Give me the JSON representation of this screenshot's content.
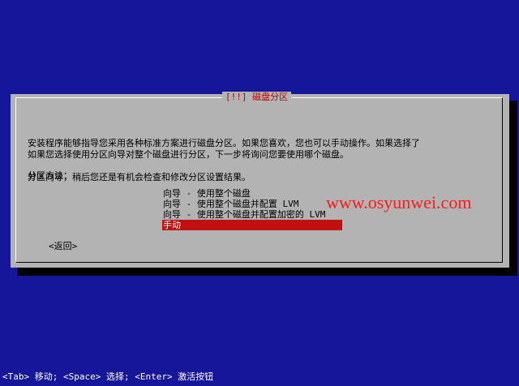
{
  "dialog": {
    "title": "[!!] 磁盘分区",
    "description_line1": "安装程序能够指导您采用各种标准方案进行磁盘分区。如果您喜欢，您也可以手动操作。如果选择了",
    "description_line2": "分区向导，稍后您还是有机会检查和修改分区设置结果。",
    "description_line3": "如果您选择使用分区向导对整个磁盘进行分区，下一步将询问您要使用哪个磁盘。",
    "method_label": "分区方法：",
    "options": [
      {
        "label": "向导 - 使用整个磁盘"
      },
      {
        "label": "向导 - 使用整个磁盘并配置 LVM"
      },
      {
        "label": "向导 - 使用整个磁盘并配置加密的 LVM"
      },
      {
        "label": "手动"
      }
    ],
    "selected_option": "手动",
    "back_label": "<返回>"
  },
  "status_bar": {
    "text": "<Tab> 移动; <Space> 选择; <Enter> 激活按钮"
  },
  "watermark": {
    "text": "www.osyunwei.com"
  },
  "colors": {
    "background": "#16169a",
    "dialog": "#b3b3b3",
    "selection": "#c01010",
    "title": "#c00000",
    "watermark": "#ff1a1a"
  }
}
